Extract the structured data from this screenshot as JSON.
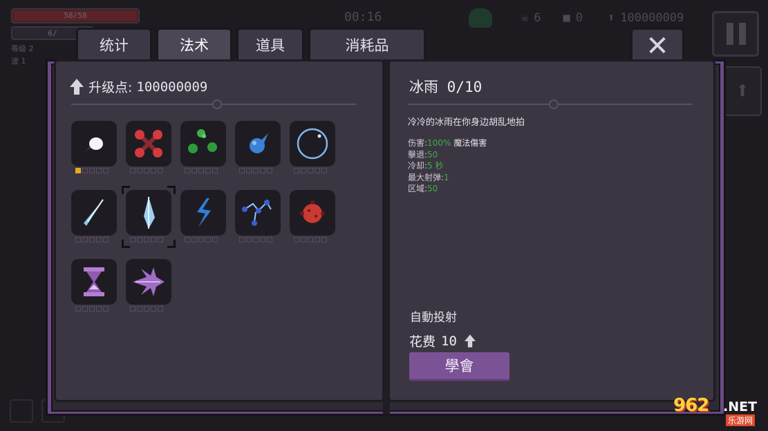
{
  "hud": {
    "hp_text": "58/58",
    "xp_text": "6/",
    "level_text": "等级 2",
    "wave_text": "波 1",
    "timer": "00:16",
    "kills": "6",
    "coins": "0",
    "upgrade_points": "100000009"
  },
  "tabs": [
    {
      "label": "统计",
      "active": false
    },
    {
      "label": "法术",
      "active": true
    },
    {
      "label": "道具",
      "active": false
    },
    {
      "label": "消耗品",
      "active": false
    }
  ],
  "left_page": {
    "upgrade_label": "升级点:",
    "upgrade_value": "100000009",
    "spells": [
      {
        "icon": "white-comet-icon",
        "level": 1,
        "max": 5
      },
      {
        "icon": "red-cross-orbs-icon",
        "level": 0,
        "max": 5
      },
      {
        "icon": "green-orbs-icon",
        "level": 0,
        "max": 5
      },
      {
        "icon": "blue-drop-icon",
        "level": 0,
        "max": 5
      },
      {
        "icon": "bubble-ring-icon",
        "level": 0,
        "max": 5
      },
      {
        "icon": "ice-shard-icon",
        "level": 0,
        "max": 5
      },
      {
        "icon": "ice-rain-icon",
        "level": 0,
        "max": 5,
        "selected": true
      },
      {
        "icon": "lightning-bolt-icon",
        "level": 0,
        "max": 5
      },
      {
        "icon": "chain-lightning-icon",
        "level": 0,
        "max": 5
      },
      {
        "icon": "red-bomb-icon",
        "level": 0,
        "max": 5
      },
      {
        "icon": "hourglass-icon",
        "level": 0,
        "max": 5
      },
      {
        "icon": "purple-spikes-icon",
        "level": 0,
        "max": 5
      }
    ]
  },
  "right_page": {
    "name": "冰雨",
    "level": "0/10",
    "description": "冷冷的冰雨在你身边胡乱地拍",
    "stats": [
      {
        "label": "伤害:",
        "value": "100%",
        "suffix": "魔法傷害"
      },
      {
        "label": "擊退:",
        "value": "50",
        "suffix": ""
      },
      {
        "label": "冷却:",
        "value": "5 秒",
        "suffix": ""
      },
      {
        "label": "最大射弹:",
        "value": "1",
        "suffix": ""
      },
      {
        "label": "区域:",
        "value": "50",
        "suffix": ""
      }
    ],
    "auto_cast": "自動投射",
    "cost_label": "花费",
    "cost_value": "10",
    "learn_button": "學會"
  },
  "watermark": {
    "brand": "962",
    "domain": ".NET",
    "sub": "乐游网"
  },
  "colors": {
    "accent_purple": "#7b5296",
    "stat_green": "#3fae48",
    "pip_gold": "#e8a823"
  }
}
